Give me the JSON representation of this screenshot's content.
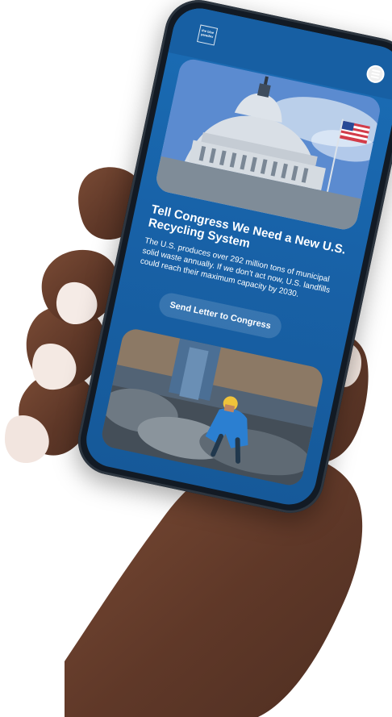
{
  "brand": {
    "logo_text": "the blue paradox"
  },
  "header": {
    "menu_icon": "menu-icon"
  },
  "hero": {
    "icon": "capitol-dome-image"
  },
  "content": {
    "headline": "Tell Congress We Need a New U.S. Recycling System",
    "body": "The U.S. produces over 292 million tons of municipal solid waste annually. If we don't act now, U.S. landfills could reach their maximum capacity by 2030.",
    "cta_label": "Send Letter to Congress"
  },
  "secondary_image": {
    "icon": "recycling-worker-image"
  },
  "colors": {
    "screen_blue": "#1a6db5",
    "button_bg": "rgba(255,255,255,0.14)",
    "text_white": "#ffffff"
  }
}
